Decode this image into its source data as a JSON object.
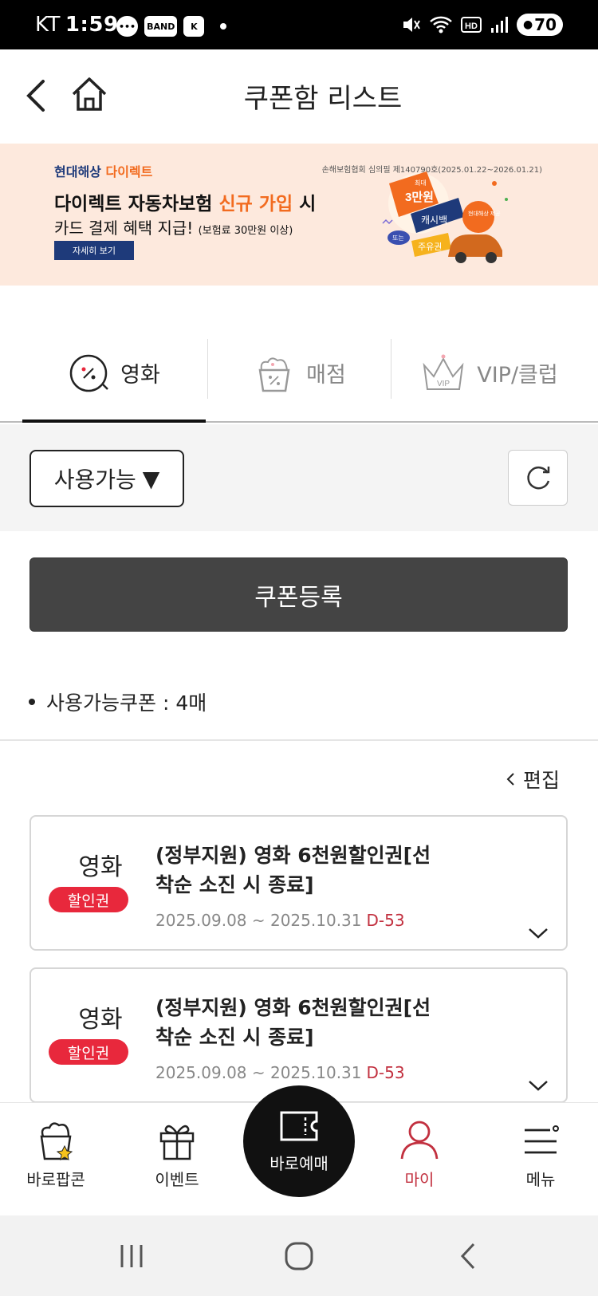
{
  "status_bar": {
    "carrier": "KT",
    "time": "1:59",
    "notif_chips": [
      "BAND",
      "K"
    ],
    "battery": "70"
  },
  "header": {
    "title": "쿠폰함 리스트"
  },
  "banner": {
    "brand_a": "현대해상",
    "brand_b": "다이렉트",
    "note": "손해보험협회 심의필 제140790호(2025.01.22~2026.01.21)",
    "line1_a": "다이렉트 자동차보험 ",
    "line1_hl": "신규 가입",
    "line1_b": " 시",
    "line2": "카드 결제 혜택 지급!",
    "line2_small": "(보험료 30만원 이상)",
    "button": "자세히 보기",
    "art": {
      "tag_max": "최대",
      "tag_amount": "3만원",
      "tag_cashback": "캐시백",
      "tag_or": "또는",
      "tag_oil": "주유권",
      "tag_brand": "현대해상 제공"
    },
    "accent_color": "#f26b1f",
    "brand_color": "#1e3a7a"
  },
  "tabs": [
    {
      "label": "영화",
      "icon": "movie-coupon-icon",
      "active": true
    },
    {
      "label": "매점",
      "icon": "popcorn-coupon-icon",
      "active": false
    },
    {
      "label": "VIP/클럽",
      "icon": "vip-crown-icon",
      "active": false
    }
  ],
  "filter": {
    "selected": "사용가능",
    "arrow": "▼"
  },
  "register_label": "쿠폰등록",
  "available_count": "사용가능쿠폰 : 4매",
  "edit_label": "편집",
  "coupons": [
    {
      "category": "영화",
      "badge": "할인권",
      "title": "(정부지원) 영화 6천원할인권[선착순 소진 시 종료]",
      "period": "2025.09.08 ~ 2025.10.31",
      "dday": "D-53"
    },
    {
      "category": "영화",
      "badge": "할인권",
      "title": "(정부지원) 영화 6천원할인권[선착순 소진 시 종료]",
      "period": "2025.09.08 ~ 2025.10.31",
      "dday": "D-53"
    }
  ],
  "bottom_nav": {
    "items": [
      {
        "label": "바로팝콘",
        "icon": "popcorn-icon"
      },
      {
        "label": "이벤트",
        "icon": "gift-icon"
      },
      {
        "label": "바로예매",
        "icon": "ticket-icon"
      },
      {
        "label": "마이",
        "icon": "person-icon",
        "active": true
      },
      {
        "label": "메뉴",
        "icon": "menu-icon"
      }
    ],
    "active_color": "#c2303f"
  }
}
